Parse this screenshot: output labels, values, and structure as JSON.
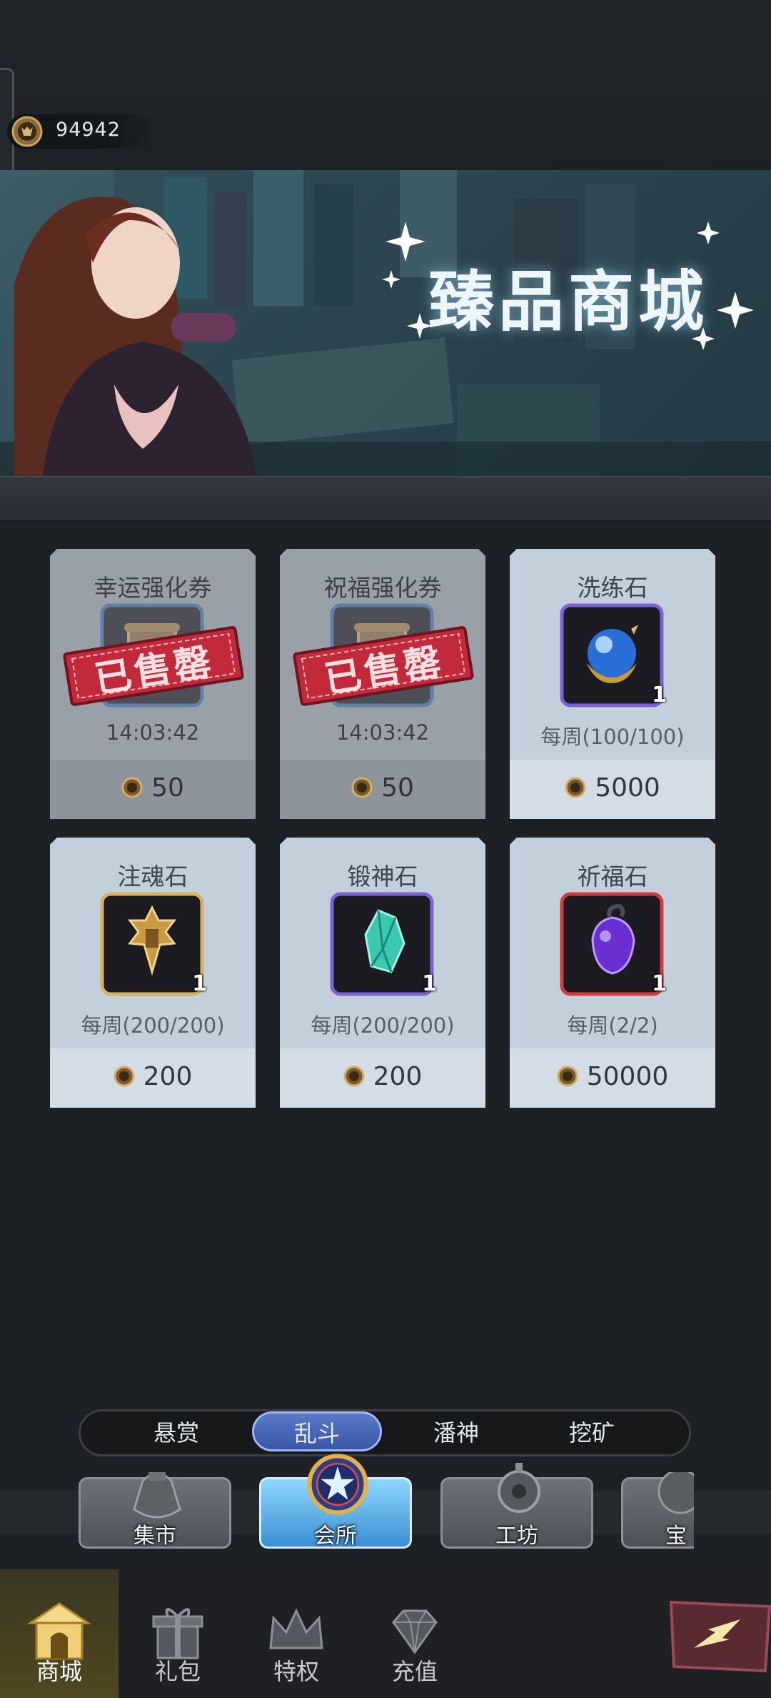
{
  "currency": {
    "icon": "gold-coin-icon",
    "amount": "94942"
  },
  "banner": {
    "title": "臻品商城"
  },
  "shop_items": [
    {
      "name": "幸运强化券",
      "icon": "scroll-icon",
      "status": "已售罄",
      "timer": "14:03:42",
      "price": "50",
      "sold_out": true
    },
    {
      "name": "祝福强化券",
      "icon": "scroll-icon",
      "status": "已售罄",
      "timer": "14:03:42",
      "price": "50",
      "sold_out": true
    },
    {
      "name": "洗练石",
      "icon": "blue-orb-icon",
      "qty": "1",
      "limit": "每周(100/100)",
      "price": "5000",
      "sold_out": false
    },
    {
      "name": "注魂石",
      "icon": "gold-crest-icon",
      "qty": "1",
      "limit": "每周(200/200)",
      "price": "200",
      "sold_out": false
    },
    {
      "name": "锻神石",
      "icon": "green-crystal-icon",
      "qty": "1",
      "limit": "每周(200/200)",
      "price": "200",
      "sold_out": false
    },
    {
      "name": "祈福石",
      "icon": "purple-gem-icon",
      "qty": "1",
      "limit": "每周(2/2)",
      "price": "50000",
      "sold_out": false
    }
  ],
  "sub_tabs": [
    {
      "label": "悬赏",
      "active": false
    },
    {
      "label": "乱斗",
      "active": true
    },
    {
      "label": "潘神",
      "active": false
    },
    {
      "label": "挖矿",
      "active": false
    }
  ],
  "categories": [
    {
      "label": "集市",
      "icon": "money-bag-icon",
      "active": false
    },
    {
      "label": "会所",
      "icon": "star-emblem-icon",
      "active": true
    },
    {
      "label": "工坊",
      "icon": "gear-icon",
      "active": false
    },
    {
      "label": "宝",
      "icon": "treasure-icon",
      "active": false
    }
  ],
  "bottom_nav": [
    {
      "label": "商城",
      "icon": "shop-building-icon",
      "active": true
    },
    {
      "label": "礼包",
      "icon": "gift-box-icon",
      "active": false
    },
    {
      "label": "特权",
      "icon": "crown-icon",
      "active": false
    },
    {
      "label": "充值",
      "icon": "diamond-icon",
      "active": false
    }
  ],
  "colors": {
    "card_light": "#d4dde6",
    "card_sold": "#8e949b",
    "stamp_red": "#c22a3c",
    "tab_active": "#4766b8"
  }
}
